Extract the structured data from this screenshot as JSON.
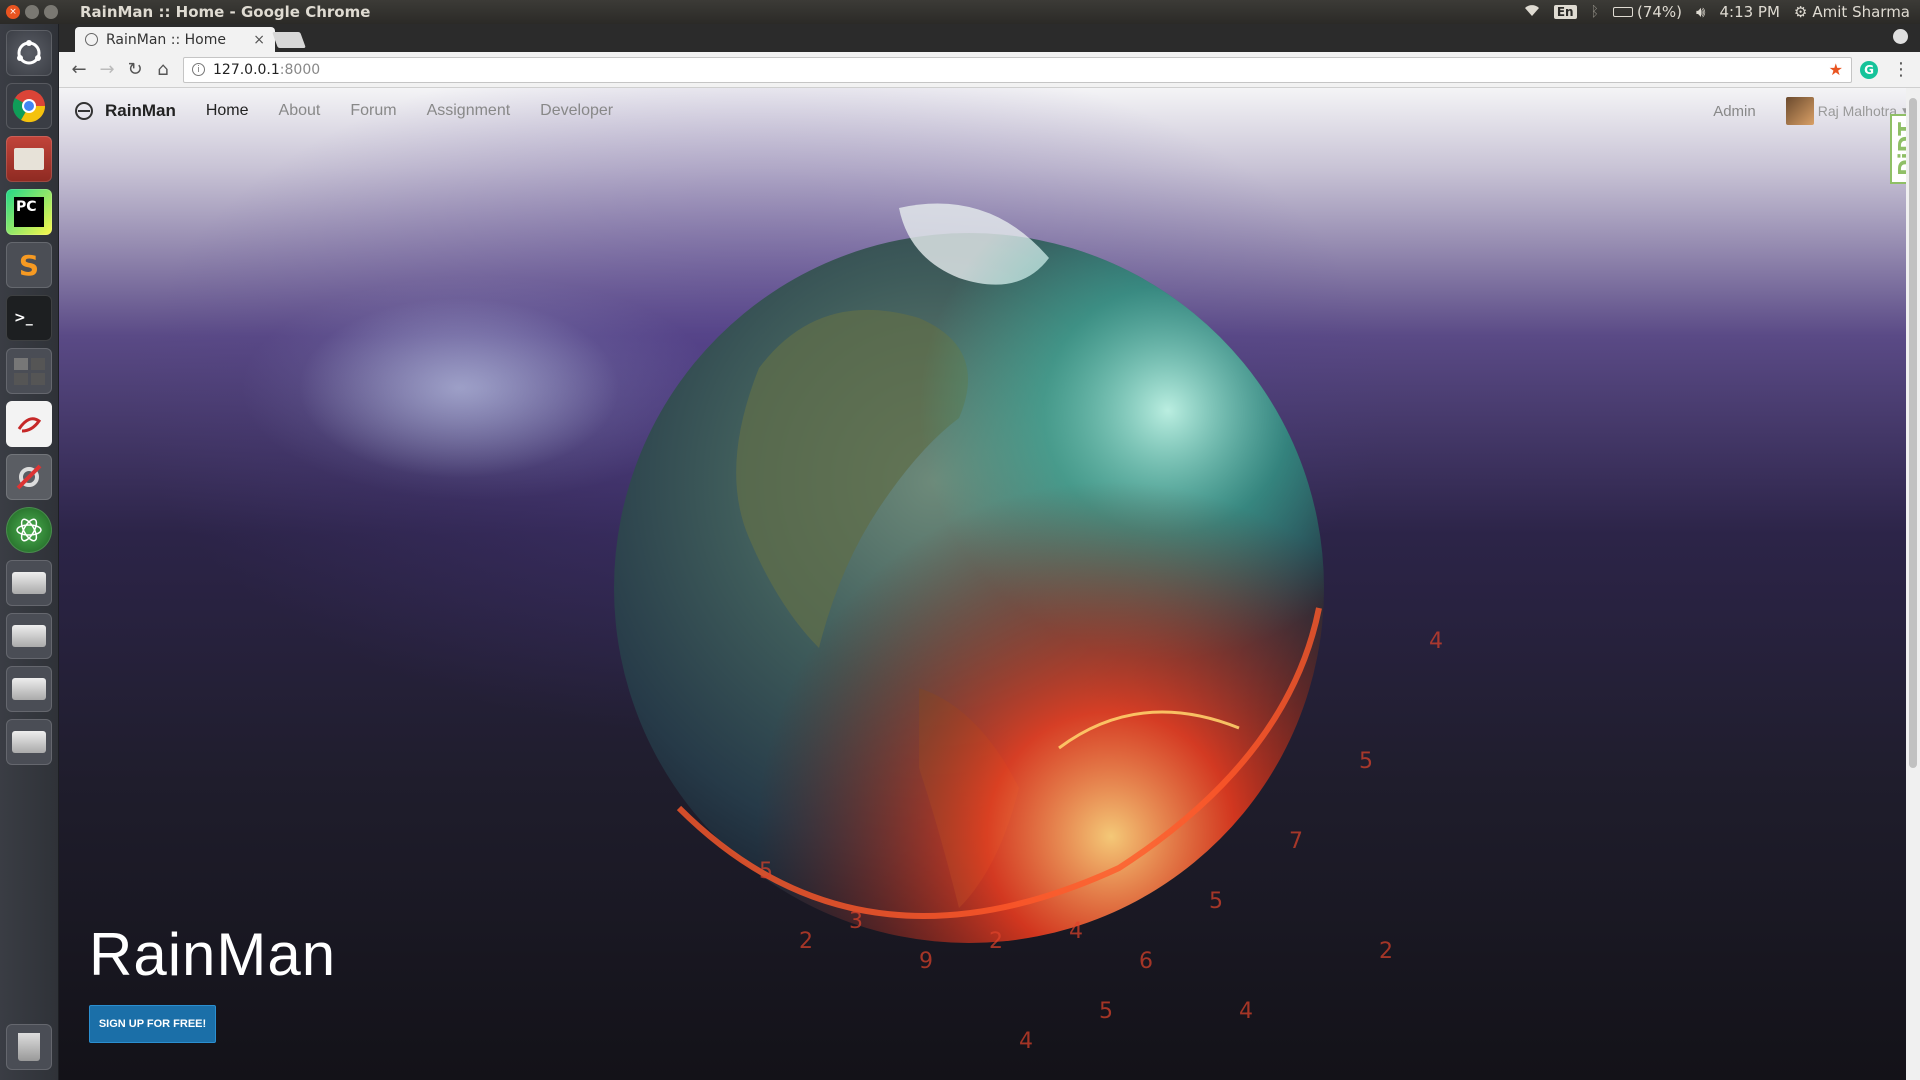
{
  "os_panel": {
    "window_title": "RainMan :: Home - Google Chrome",
    "keyboard": "En",
    "battery": "(74%)",
    "time": "4:13 PM",
    "user": "Amit Sharma"
  },
  "launcher": {
    "apps": [
      "ubuntu-dash",
      "chrome",
      "files",
      "pycharm",
      "sublime-text",
      "terminal",
      "workspace-switcher",
      "text-editor",
      "system-settings",
      "atom",
      "drive",
      "drive",
      "drive",
      "drive",
      "trash"
    ],
    "pycharm_label": "PC",
    "sublime_label": "S",
    "terminal_label": ">_"
  },
  "browser": {
    "tab_title": "RainMan :: Home",
    "tab_close": "×",
    "url_host": "127.0.0.1",
    "url_port": ":8000",
    "extension_label": "G"
  },
  "navbar": {
    "brand": "RainMan",
    "links": [
      "Home",
      "About",
      "Forum",
      "Assignment",
      "Developer"
    ],
    "active_link": "Home",
    "admin": "Admin",
    "user_name": "Raj Malhotra"
  },
  "debug_toolbar": {
    "label": "DjDT"
  },
  "hero": {
    "title": "RainMan",
    "cta": "SIGN UP FOR FREE!"
  },
  "colors": {
    "ubuntu_orange": "#e95420",
    "cta_blue": "#1b6fa8",
    "djdt_green": "#8fbf66"
  }
}
